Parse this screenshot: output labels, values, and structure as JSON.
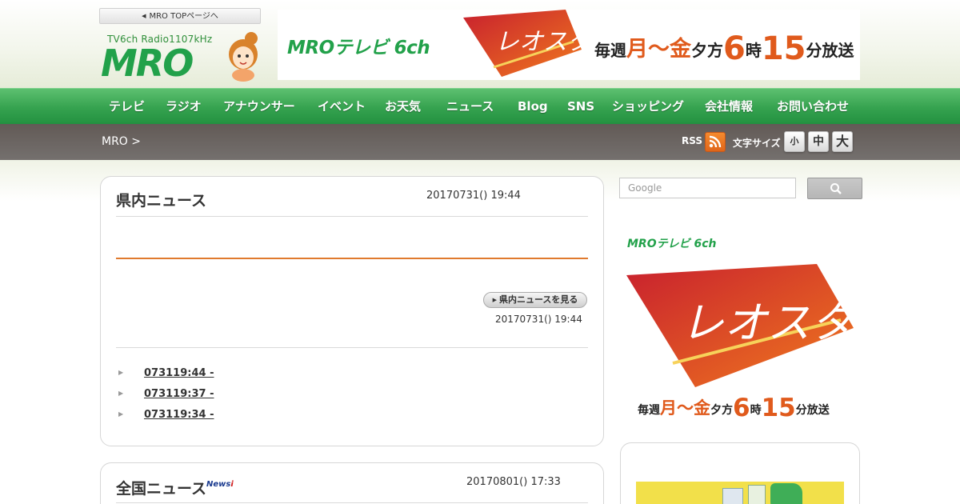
{
  "header": {
    "top_link": "MRO TOPページへ",
    "logo_sub": "TV6ch  Radio1107kHz",
    "logo_main": "MRO"
  },
  "banner": {
    "channel": "MROテレビ 6ch",
    "program": "レオスタ",
    "schedule_prefix": "毎週",
    "schedule_days": "月〜金",
    "schedule_mid": "夕方",
    "hour": "6",
    "hour_unit": "時",
    "minute": "15",
    "minute_unit": "分放送"
  },
  "nav": {
    "items": [
      "テレビ",
      "ラジオ",
      "アナウンサー",
      "イベント",
      "お天気",
      "ニュース",
      "Blog",
      "SNS",
      "ショッピング",
      "会社情報",
      "お問い合わせ"
    ]
  },
  "breadcrumb": {
    "text": "MRO >"
  },
  "tools": {
    "rss_label": "RSS",
    "size_label": "文字サイズ",
    "size_small": "小",
    "size_medium": "中",
    "size_large": "大"
  },
  "local_news": {
    "title": "県内ニュース",
    "date": "20170731() 19:44",
    "more_button": "県内ニュースを見る",
    "more_date": "20170731() 19:44",
    "items": [
      "073119:44 -",
      "073119:37 -",
      "073119:34 -"
    ]
  },
  "national_news": {
    "title": "全国ニュース",
    "badge": "News",
    "badge_i": "i",
    "date": "20170801() 17:33"
  },
  "sidebar": {
    "search_placeholder": "Google",
    "banner_channel": "MROテレビ 6ch",
    "banner_program": "レオスタ",
    "schedule_prefix": "毎週",
    "schedule_days": "月〜金",
    "schedule_mid": "夕方",
    "hour": "6",
    "hour_unit": "時",
    "minute": "15",
    "minute_unit": "分放送"
  },
  "colors": {
    "brand_green": "#22a14a",
    "nav_green": "#35a24f",
    "accent_orange": "#e05a1c",
    "program_red": "#c8202e",
    "bar_gray": "#6a6461"
  }
}
